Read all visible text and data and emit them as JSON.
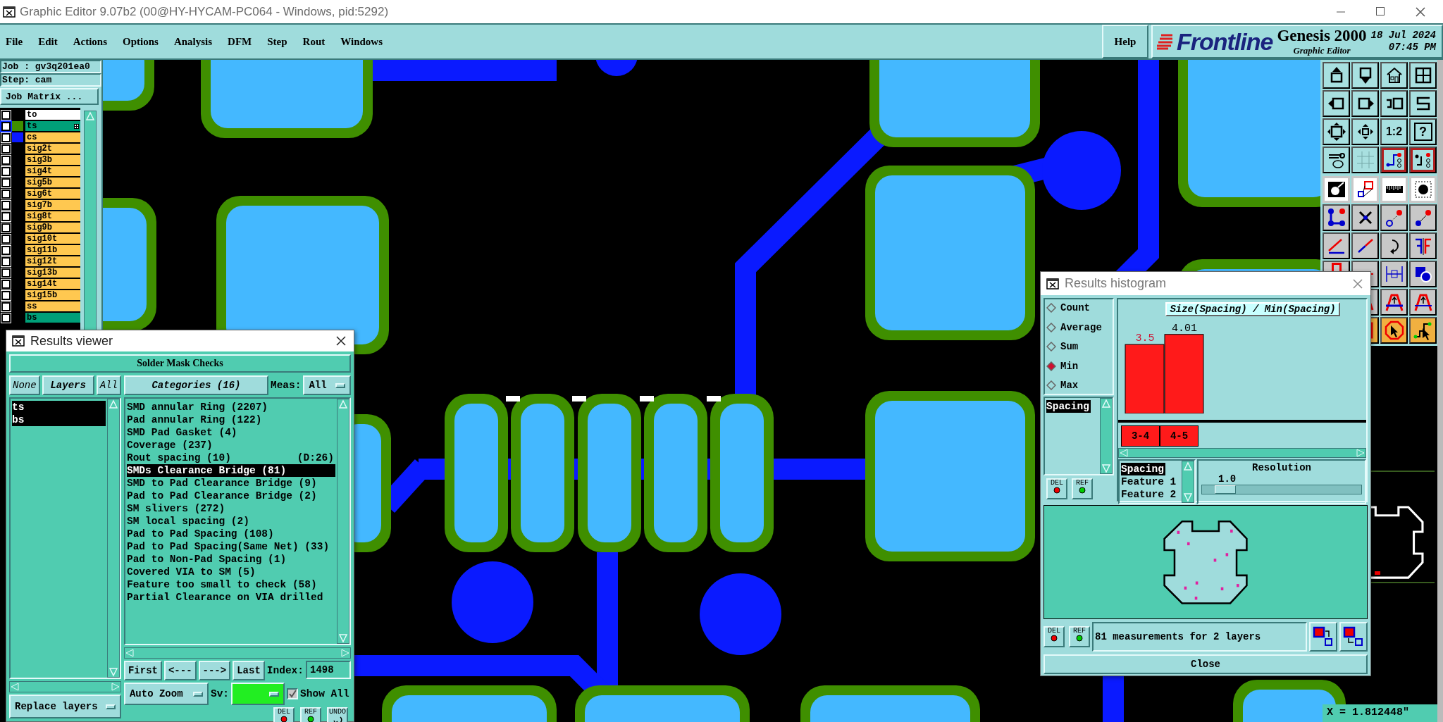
{
  "window": {
    "title": "Graphic Editor 9.07b2 (00@HY-HYCAM-PC064 - Windows, pid:5292)"
  },
  "menu": [
    {
      "label": "File"
    },
    {
      "label": "Edit"
    },
    {
      "label": "Actions"
    },
    {
      "label": "Options"
    },
    {
      "label": "Analysis"
    },
    {
      "label": "DFM"
    },
    {
      "label": "Step"
    },
    {
      "label": "Rout"
    },
    {
      "label": "Windows"
    }
  ],
  "help": "Help",
  "brand": {
    "name": "Frontline",
    "product": "Genesis 2000",
    "module": "Graphic Editor",
    "date": "18 Jul 2024",
    "time": "07:45 PM"
  },
  "job": {
    "job": "Job : gv3q201ea0",
    "step": "Step: cam",
    "matrix_button": "Job Matrix ..."
  },
  "layers": [
    {
      "name": "to",
      "kind": "work",
      "checked": false,
      "selected": false
    },
    {
      "name": "ts",
      "kind": "affected",
      "color": "#3f8f00",
      "checked": false,
      "selected": true
    },
    {
      "name": "cs",
      "kind": "board",
      "color": "#0a1aff",
      "checked": false,
      "selected": false
    },
    {
      "name": "sig2t",
      "kind": "board",
      "checked": false,
      "selected": false
    },
    {
      "name": "sig3b",
      "kind": "board",
      "checked": false,
      "selected": false
    },
    {
      "name": "sig4t",
      "kind": "board",
      "checked": false,
      "selected": false
    },
    {
      "name": "sig5b",
      "kind": "board",
      "checked": false,
      "selected": false
    },
    {
      "name": "sig6t",
      "kind": "board",
      "checked": false,
      "selected": false
    },
    {
      "name": "sig7b",
      "kind": "board",
      "checked": false,
      "selected": false
    },
    {
      "name": "sig8t",
      "kind": "board",
      "checked": false,
      "selected": false
    },
    {
      "name": "sig9b",
      "kind": "board",
      "checked": false,
      "selected": false
    },
    {
      "name": "sig10t",
      "kind": "board",
      "checked": false,
      "selected": false
    },
    {
      "name": "sig11b",
      "kind": "board",
      "checked": false,
      "selected": false
    },
    {
      "name": "sig12t",
      "kind": "board",
      "checked": false,
      "selected": false
    },
    {
      "name": "sig13b",
      "kind": "board",
      "checked": false,
      "selected": false
    },
    {
      "name": "sig14t",
      "kind": "board",
      "checked": false,
      "selected": false
    },
    {
      "name": "sig15b",
      "kind": "board",
      "checked": false,
      "selected": false
    },
    {
      "name": "ss",
      "kind": "board",
      "checked": false,
      "selected": false
    },
    {
      "name": "bs",
      "kind": "affected",
      "checked": false,
      "selected": false
    }
  ],
  "toolbar": {
    "scale": "1:2",
    "help": "?"
  },
  "status": "X = 1.812448\"",
  "results_viewer": {
    "title": "Results viewer",
    "heading": "Solder Mask Checks",
    "layer_buttons": [
      "None",
      "Layers",
      "All"
    ],
    "layers": [
      {
        "name": "ts",
        "selected": true
      },
      {
        "name": "bs",
        "selected": true
      }
    ],
    "replace": "Replace layers",
    "categories_button": "Categories (16)",
    "meas_label": "Meas:",
    "meas_value": "All",
    "categories": [
      {
        "label": "SMD annular Ring (2207)",
        "selected": false
      },
      {
        "label": "Pad annular Ring (122)",
        "selected": false
      },
      {
        "label": "SMD Pad Gasket (4)",
        "selected": false
      },
      {
        "label": "Coverage (237)",
        "selected": false
      },
      {
        "label": "Rout spacing (10)",
        "note": "(D:26)",
        "selected": false
      },
      {
        "label": "SMDs Clearance Bridge (81)",
        "selected": true
      },
      {
        "label": "SMD to Pad Clearance Bridge (9)",
        "selected": false
      },
      {
        "label": "Pad to Pad Clearance Bridge (2)",
        "selected": false
      },
      {
        "label": "SM slivers (272)",
        "selected": false
      },
      {
        "label": "SM local spacing (2)",
        "selected": false
      },
      {
        "label": "Pad to Pad Spacing (108)",
        "selected": false
      },
      {
        "label": "Pad to Pad Spacing(Same Net) (33)",
        "selected": false
      },
      {
        "label": "Pad to Non-Pad Spacing (1)",
        "selected": false
      },
      {
        "label": "Covered VIA to SM (5)",
        "selected": false
      },
      {
        "label": "Feature too small to check (58)",
        "selected": false
      },
      {
        "label": "Partial Clearance on VIA drilled",
        "selected": false
      }
    ],
    "nav": [
      "First",
      "<---",
      "--->",
      "Last"
    ],
    "index_label": "Index:",
    "index_value": "1498",
    "zoom": "Auto Zoom",
    "severity": {
      "label": "Sv:",
      "color": "#22ee22"
    },
    "show_all": {
      "label": "Show All",
      "checked": true
    },
    "icon_buttons": [
      "DEL",
      "REF",
      "UNDO"
    ]
  },
  "histogram": {
    "title": "Results histogram",
    "modes": [
      {
        "label": "Count",
        "selected": false
      },
      {
        "label": "Average",
        "selected": false
      },
      {
        "label": "Sum",
        "selected": false
      },
      {
        "label": "Min",
        "selected": true
      },
      {
        "label": "Max",
        "selected": false
      }
    ],
    "fields": [
      {
        "label": "Spacing",
        "selected": true
      }
    ],
    "field_buttons": [
      "DEL",
      "REF"
    ],
    "chart_data": {
      "type": "bar",
      "title": "Size(Spacing) / Min(Spacing)",
      "categories": [
        "3-4",
        "4-5"
      ],
      "values": [
        3.5,
        4.01
      ],
      "data_labels": true
    },
    "bins": [
      {
        "selected": true
      },
      {
        "selected": false
      }
    ],
    "axes": [
      {
        "label": "Spacing",
        "selected": true
      },
      {
        "label": "Feature 1",
        "selected": false
      },
      {
        "label": "Feature 2",
        "selected": false
      }
    ],
    "resolution": {
      "label": "Resolution",
      "value": "1.0",
      "level": 0.08
    },
    "bottom_buttons": [
      "DEL",
      "REF"
    ],
    "summary": "81 measurements for 2 layers",
    "close": "Close"
  }
}
